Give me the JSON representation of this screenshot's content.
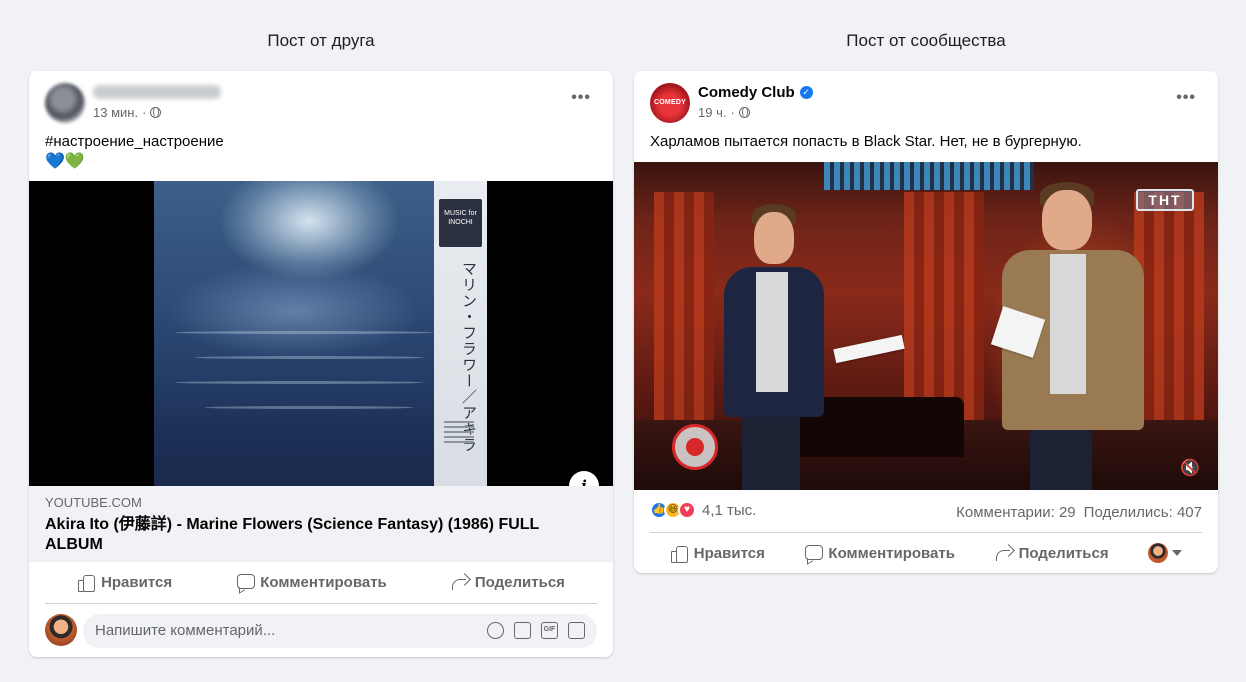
{
  "left_column": {
    "title": "Пост от друга",
    "post": {
      "time": "13 мин.",
      "text": "#настроение_настроение",
      "emoji": "💙💚",
      "album": {
        "obi_text": "MUSIC for INOCHI",
        "obi_japanese": "マリン・フラワー／アキラ"
      },
      "link": {
        "domain": "YOUTUBE.COM",
        "title": "Akira Ito (伊藤詳) - Marine Flowers (Science Fantasy) (1986) FULL ALBUM"
      },
      "actions": {
        "like": "Нравится",
        "comment": "Комментировать",
        "share": "Поделиться"
      },
      "comment_placeholder": "Напишите комментарий...",
      "comment_icons": [
        "smile-icon",
        "camera-icon",
        "gif-icon",
        "sticker-icon"
      ]
    }
  },
  "right_column": {
    "title": "Пост от сообщества",
    "post": {
      "page_name": "Comedy Club",
      "avatar_text": "COMEDY",
      "time": "19 ч.",
      "text": "Харламов пытается попасть в Black Star. Нет, не в бургерную.",
      "channel_logo": "ТНТ",
      "reactions_count": "4,1 тыс.",
      "comments": "Комментарии: 29",
      "shares": "Поделились: 407",
      "actions": {
        "like": "Нравится",
        "comment": "Комментировать",
        "share": "Поделиться"
      }
    }
  },
  "colors": {
    "background": "#f0f2f5",
    "accent": "#1877f2",
    "secondary_text": "#65676b"
  }
}
